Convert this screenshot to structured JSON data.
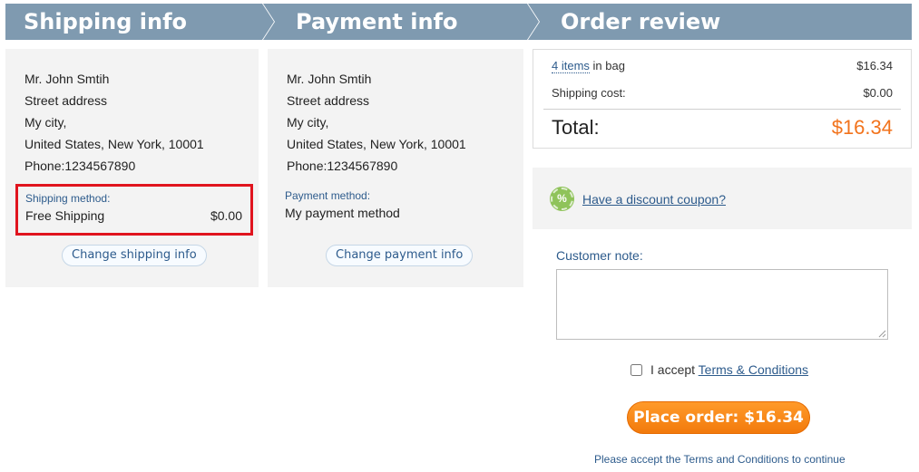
{
  "steps": [
    {
      "label": "Shipping info"
    },
    {
      "label": "Payment info"
    },
    {
      "label": "Order review"
    }
  ],
  "shipping": {
    "address_lines": [
      "Mr. John Smtih",
      "Street address",
      "My city,",
      "United States, New York, 10001",
      "Phone:1234567890"
    ],
    "method_label": "Shipping method:",
    "method_name": "Free Shipping",
    "method_price": "$0.00",
    "change_label": "Change shipping info"
  },
  "payment": {
    "address_lines": [
      "Mr. John Smtih",
      "Street address",
      "My city,",
      "United States, New York, 10001",
      "Phone:1234567890"
    ],
    "method_label": "Payment method:",
    "method_name": "My payment method",
    "change_label": "Change payment info"
  },
  "review": {
    "items_link": "4 items",
    "items_suffix": " in bag",
    "items_amount": "$16.34",
    "shipping_label": "Shipping cost:",
    "shipping_amount": "$0.00",
    "total_label": "Total:",
    "total_amount": "$16.34"
  },
  "coupon": {
    "icon": "percent-badge-icon",
    "icon_glyph": "%",
    "link": "Have a discount coupon?"
  },
  "note": {
    "label": "Customer note:",
    "value": ""
  },
  "terms": {
    "prefix": "I accept ",
    "link": "Terms & Conditions",
    "checked": false
  },
  "place_order_label": "Place order: $16.34",
  "terms_warning": "Please accept the Terms and Conditions to continue",
  "colors": {
    "header_bar": "#7f9ab0",
    "accent_orange": "#f2731c",
    "link_blue": "#2d5b8c",
    "highlight_red": "#e0141e"
  }
}
